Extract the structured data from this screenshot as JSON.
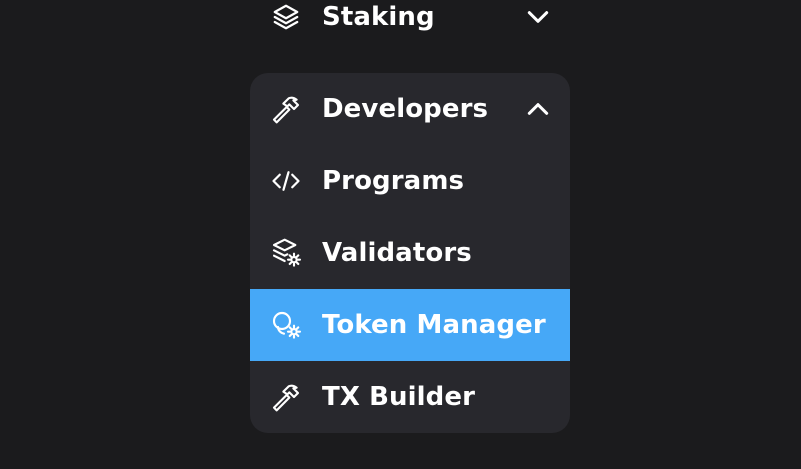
{
  "nav": {
    "staking": {
      "label": "Staking",
      "icon": "layers-icon",
      "state": "collapsed"
    },
    "developers": {
      "label": "Developers",
      "icon": "hammer-icon",
      "state": "expanded",
      "items": [
        {
          "label": "Programs",
          "icon": "code-icon"
        },
        {
          "label": "Validators",
          "icon": "stack-gear-icon"
        },
        {
          "label": "Token Manager",
          "icon": "coins-gear-icon",
          "active": true
        },
        {
          "label": "TX Builder",
          "icon": "hammer-icon"
        }
      ]
    }
  },
  "colors": {
    "background": "#1b1b1d",
    "panel": "#28282d",
    "active": "#46a8f7",
    "text": "#ffffff"
  }
}
